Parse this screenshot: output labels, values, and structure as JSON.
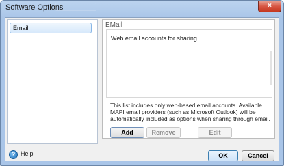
{
  "window": {
    "title": "Software Options",
    "close_glyph": "×"
  },
  "sidebar": {
    "items": [
      {
        "label": "Email",
        "selected": true
      }
    ]
  },
  "email_section": {
    "title": "EMail",
    "list_header": "Web email accounts for sharing",
    "info": "This list includes only web-based email accounts.  Available MAPI email providers (such as Microsoft Outlook) will be automatically included as options when sharing through email.",
    "buttons": {
      "add": "Add",
      "remove": "Remove",
      "edit": "Edit"
    }
  },
  "footer": {
    "help_icon_glyph": "?",
    "help_label": "Help",
    "ok_label": "OK",
    "cancel_label": "Cancel"
  },
  "colors": {
    "frame": "#a9c5e8",
    "client_background": "#f0f0f0",
    "selection": "#d7e9fb",
    "close_button": "#d5533f"
  },
  "icons": {
    "close": "close-icon",
    "help": "help-icon"
  }
}
